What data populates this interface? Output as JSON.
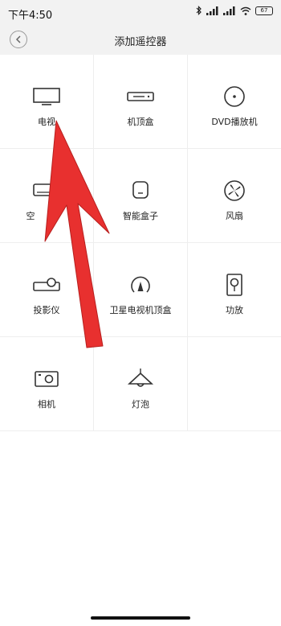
{
  "status_bar": {
    "time": "下午4:50",
    "battery": "67"
  },
  "header": {
    "title": "添加遥控器",
    "back_icon": "chevron-left-icon"
  },
  "devices": [
    {
      "label": "电视",
      "icon": "tv-icon"
    },
    {
      "label": "机顶盒",
      "icon": "set-top-box-icon"
    },
    {
      "label": "DVD播放机",
      "icon": "dvd-icon"
    },
    {
      "label": "空",
      "icon": "air-conditioner-icon"
    },
    {
      "label": "智能盒子",
      "icon": "smart-box-icon"
    },
    {
      "label": "风扇",
      "icon": "fan-icon"
    },
    {
      "label": "投影仪",
      "icon": "projector-icon"
    },
    {
      "label": "卫星电视机顶盒",
      "icon": "satellite-dish-icon"
    },
    {
      "label": "功放",
      "icon": "amplifier-icon"
    },
    {
      "label": "相机",
      "icon": "camera-icon"
    },
    {
      "label": "灯泡",
      "icon": "light-bulb-icon"
    }
  ],
  "colors": {
    "arrow": "#e8302f",
    "header_bg": "#f2f2f2"
  }
}
